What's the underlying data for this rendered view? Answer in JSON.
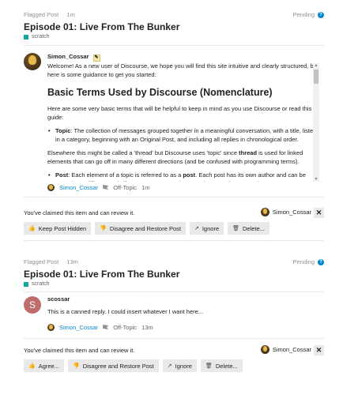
{
  "reviews": [
    {
      "flag_label": "Flagged Post",
      "flag_time": "1m",
      "status": "Pending",
      "topic_title": "Episode 01: Live From The Bunker",
      "category": "scratch",
      "post": {
        "username": "Simon_Cossar",
        "intro": "Welcome! As a new user of Discourse, we hope you will find this site intuitive and clearly structured, but here is some guidance to get you started:",
        "heading": "Basic Terms Used by Discourse (Nomenclature)",
        "para1": "Here are some very basic terms that will be helpful to keep in mind as you use Discourse or read this guide:",
        "topic_term": "Topic",
        "topic_def": ": The collection of messages grouped together in a meaningful conversation, with a title, listed in a category, beginning with an Original Post, and including all replies in chronological order.",
        "para2_a": "Elsewhere this might be called a 'thread' but Discourse uses 'topic' since ",
        "para2_bold": "thread",
        "para2_b": " is used for linked elements that can go off in many different directions (and be confused with programming terms).",
        "post_term": "Post",
        "post_def_a": ": Each element of a topic is referred to as a ",
        "post_def_bold": "post",
        "post_def_b": ". Each post has its own author and can be moved to a different topic if necessary, or even become the start of a new topic."
      },
      "meta": {
        "user": "Simon_Cossar",
        "flag": "Off-Topic",
        "time": "1m"
      },
      "claim_text": "You've claimed this item and can review it.",
      "claimed_by": "Simon_Cossar",
      "unclaim": "✕",
      "actions": [
        "Keep Post Hidden",
        "Disagree and Restore Post",
        "Ignore",
        "Delete..."
      ]
    },
    {
      "flag_label": "Flagged Post",
      "flag_time": "13m",
      "status": "Pending",
      "topic_title": "Episode 01: Live From The Bunker",
      "category": "scratch",
      "post": {
        "avatar_letter": "S",
        "username": "scossar",
        "text": "This is a canned reply. I could insert whatever I want here..."
      },
      "meta": {
        "user": "Simon_Cossar",
        "flag": "Off-Topic",
        "time": "13m"
      },
      "claim_text": "You've claimed this item and can review it.",
      "claimed_by": "Simon_Cossar",
      "unclaim": "✕",
      "actions": [
        "Agree...",
        "Disagree and Restore Post",
        "Ignore",
        "Delete..."
      ]
    }
  ],
  "colors": {
    "link": "#0088cc",
    "category": "#12a89d",
    "button_bg": "#e9e9e9"
  },
  "icons": {
    "keep_hidden": "thumbs-up-icon",
    "agree": "thumbs-up-icon",
    "disagree": "thumbs-down-icon",
    "ignore": "external-link-icon",
    "delete": "trash-icon"
  }
}
